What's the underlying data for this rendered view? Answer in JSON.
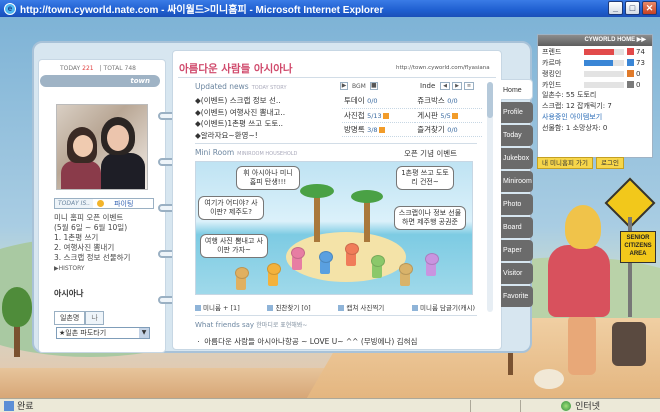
{
  "window": {
    "title": "http://town.cyworld.nate.com - 싸이월드>미니홈피 - Microsoft Internet Explorer",
    "minimize": "_",
    "maximize": "□",
    "close": "✕"
  },
  "status": {
    "left": "완료",
    "zone": "인터넷"
  },
  "profile": {
    "today_label": "TODAY",
    "today_count": "221",
    "total_label": "TOTAL",
    "total_count": "748",
    "town_logo": "town",
    "mood_label": "TODAY IS..",
    "mood_value": "파이팅",
    "intro_lines": [
      "미니 홈피 오픈 이벤트",
      "(5월 6일 ~ 6월 10일)",
      "1. 1촌평 쓰기",
      "2. 여행사진 뽐내기",
      "3. 스크랩 정보 선물하기"
    ],
    "history": "▶HISTORY",
    "owner_name": "아시아나",
    "tab_ilchon": "일촌명",
    "tab_me": "나",
    "select_value": "★일촌 파도타기"
  },
  "home": {
    "title": "아름다운 사람들 아시아나",
    "url": "http://town.cyworld.com/flyasiana",
    "updated_label": "Updated news",
    "updated_sub": "TODAY STORY",
    "news": [
      "◆(이벤트) 스크랩 정보 선..",
      "◆(이벤트) 여행사진 뽐내고..",
      "◆(이벤트)1촌평 쓰고 도토..",
      "◆알라자요~환영~!"
    ],
    "stat_head": "BGM",
    "index_label": "Inde",
    "stats": [
      {
        "name": "투데이",
        "count": "0/0",
        "new": false,
        "name2": "쥬크박스",
        "count2": "0/0",
        "new2": false
      },
      {
        "name": "사진첩",
        "count": "5/13",
        "new": true,
        "name2": "게시판",
        "count2": "5/5",
        "new2": true
      },
      {
        "name": "방명록",
        "count": "3/8",
        "new": true,
        "name2": "즐겨찾기",
        "count2": "0/0",
        "new2": false
      }
    ],
    "miniroom_label": "Mini Room",
    "miniroom_sub": "MINIROOM HOUSEHOLD",
    "miniroom_title": "오픈 기념 이벤트",
    "bubbles": [
      "휘 아시아나 미니 홈피 탄생!!!",
      "여기가 어디야? 사이판? 제주도?",
      "여행 사진 뽐내고 사이판 가자~",
      "1촌평 쓰고 도토리 건전~",
      "스크랩이나 정보 선물하면 제주행 공권준"
    ],
    "miniroom_actions": [
      "미니룸 + [1]",
      "친찬찾기 [0]",
      "캡쳐 사진찍기",
      "미니룸 담글기(캐시)"
    ],
    "friends_label": "What friends say",
    "friends_sub": "한마디로 표현해봐~",
    "friends_line": "ㆍ 아름다운 사람들 아시아나항공 ~ LOVE U~ ^^ (무빙에나) 김혀심"
  },
  "tabs": [
    "Home",
    "Profile",
    "Today",
    "Jukebox",
    "Miniroom",
    "Photo",
    "Board",
    "Paper",
    "Visitor",
    "Favorite"
  ],
  "widget": {
    "header": "CYWORLD HOME ▶▶",
    "meters": [
      {
        "name": "프렌드",
        "value": 74,
        "color": "#e24a4a"
      },
      {
        "name": "카르마",
        "value": 73,
        "color": "#3a86d6"
      },
      {
        "name": "랭킹인",
        "value": 0,
        "color": "#e07a2a"
      },
      {
        "name": "카인드",
        "value": 0,
        "color": "#7a7a7a"
      }
    ],
    "ilchon": "일촌수: 55 도토리",
    "scrap": "스크랩: 12 잡캐릭기: 7",
    "active_link": "사용중인 아이템보기",
    "gift": "선물함: 1 소망상자: 0",
    "btn_mine": "내 미니홈피 가기",
    "btn_logout": "로그인"
  },
  "sign_text": "SENIOR CITIZENS AREA",
  "colors": {
    "title_pink": "#d04a6c",
    "link_blue": "#2c6eb8",
    "accent_yellow": "#f7d64a"
  }
}
